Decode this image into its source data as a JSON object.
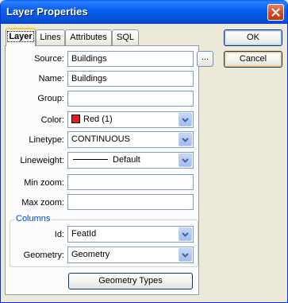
{
  "window": {
    "title": "Layer Properties"
  },
  "tabs": [
    {
      "label": "Layer",
      "active": true
    },
    {
      "label": "Lines",
      "active": false
    },
    {
      "label": "Attributes",
      "active": false
    },
    {
      "label": "SQL",
      "active": false
    }
  ],
  "form": {
    "source": {
      "label": "Source:",
      "value": "Buildings",
      "browse_label": "..."
    },
    "name": {
      "label": "Name:",
      "value": "Buildings"
    },
    "group": {
      "label": "Group:",
      "value": ""
    },
    "color": {
      "label": "Color:",
      "value": "Red (1)",
      "swatch_color": "#e01c1c"
    },
    "linetype": {
      "label": "Linetype:",
      "value": "CONTINUOUS"
    },
    "lineweight": {
      "label": "Lineweight:",
      "value": "Default"
    },
    "min_zoom": {
      "label": "Min zoom:",
      "value": ""
    },
    "max_zoom": {
      "label": "Max zoom:",
      "value": ""
    }
  },
  "columns": {
    "title": "Columns",
    "id": {
      "label": "Id:",
      "value": "FeatId"
    },
    "geometry": {
      "label": "Geometry:",
      "value": "Geometry"
    }
  },
  "geometry_types_label": "Geometry Types",
  "buttons": {
    "ok": "OK",
    "cancel": "Cancel"
  },
  "colors": {
    "title_bar": "#0b60f0",
    "dialog_bg": "#ece9d8",
    "accent": "#0046d5"
  }
}
